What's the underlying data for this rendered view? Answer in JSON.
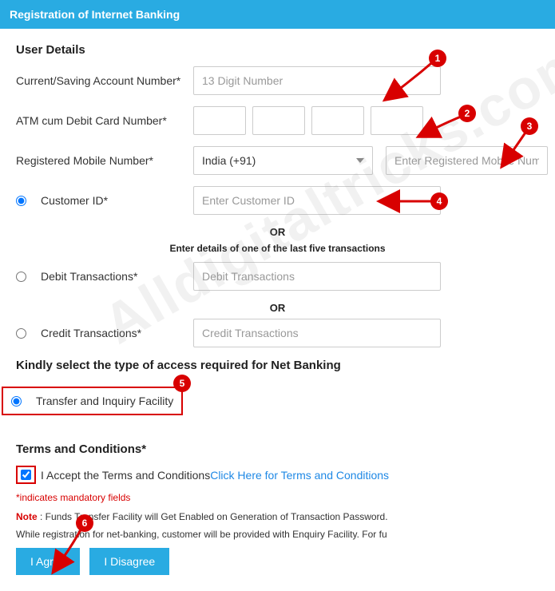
{
  "header": {
    "title": "Registration of Internet Banking"
  },
  "userDetails": {
    "section": "User Details",
    "accountLabel": "Current/Saving Account Number*",
    "accountPlaceholder": "13 Digit Number",
    "atmLabel": "ATM cum Debit Card Number*",
    "mobileLabel": "Registered Mobile Number*",
    "countryCode": "India (+91)",
    "mobilePlaceholder": "Enter Registered Mobile Number",
    "customerIdLabel": "Customer ID*",
    "customerIdPlaceholder": "Enter Customer ID",
    "or": "OR",
    "lastFive": "Enter details of one of the last five transactions",
    "debitLabel": "Debit Transactions*",
    "debitPlaceholder": "Debit Transactions",
    "creditLabel": "Credit Transactions*",
    "creditPlaceholder": "Credit Transactions"
  },
  "access": {
    "section": "Kindly select the type of access required for Net Banking",
    "option": "Transfer and Inquiry Facility"
  },
  "terms": {
    "section": "Terms and Conditions*",
    "accept": "I Accept the Terms and Conditions ",
    "link": "Click Here for Terms and Conditions",
    "mandatory": "*indicates mandatory fields",
    "noteLabel": "Note",
    "note1": " : Funds Transfer Facility will Get Enabled on Generation of Transaction Password.",
    "note2": "While registration for net-banking, customer will be provided with Enquiry Facility. For fu"
  },
  "buttons": {
    "agree": "I Agree",
    "disagree": "I Disagree"
  },
  "watermark": "Alldigitaltricks.com"
}
